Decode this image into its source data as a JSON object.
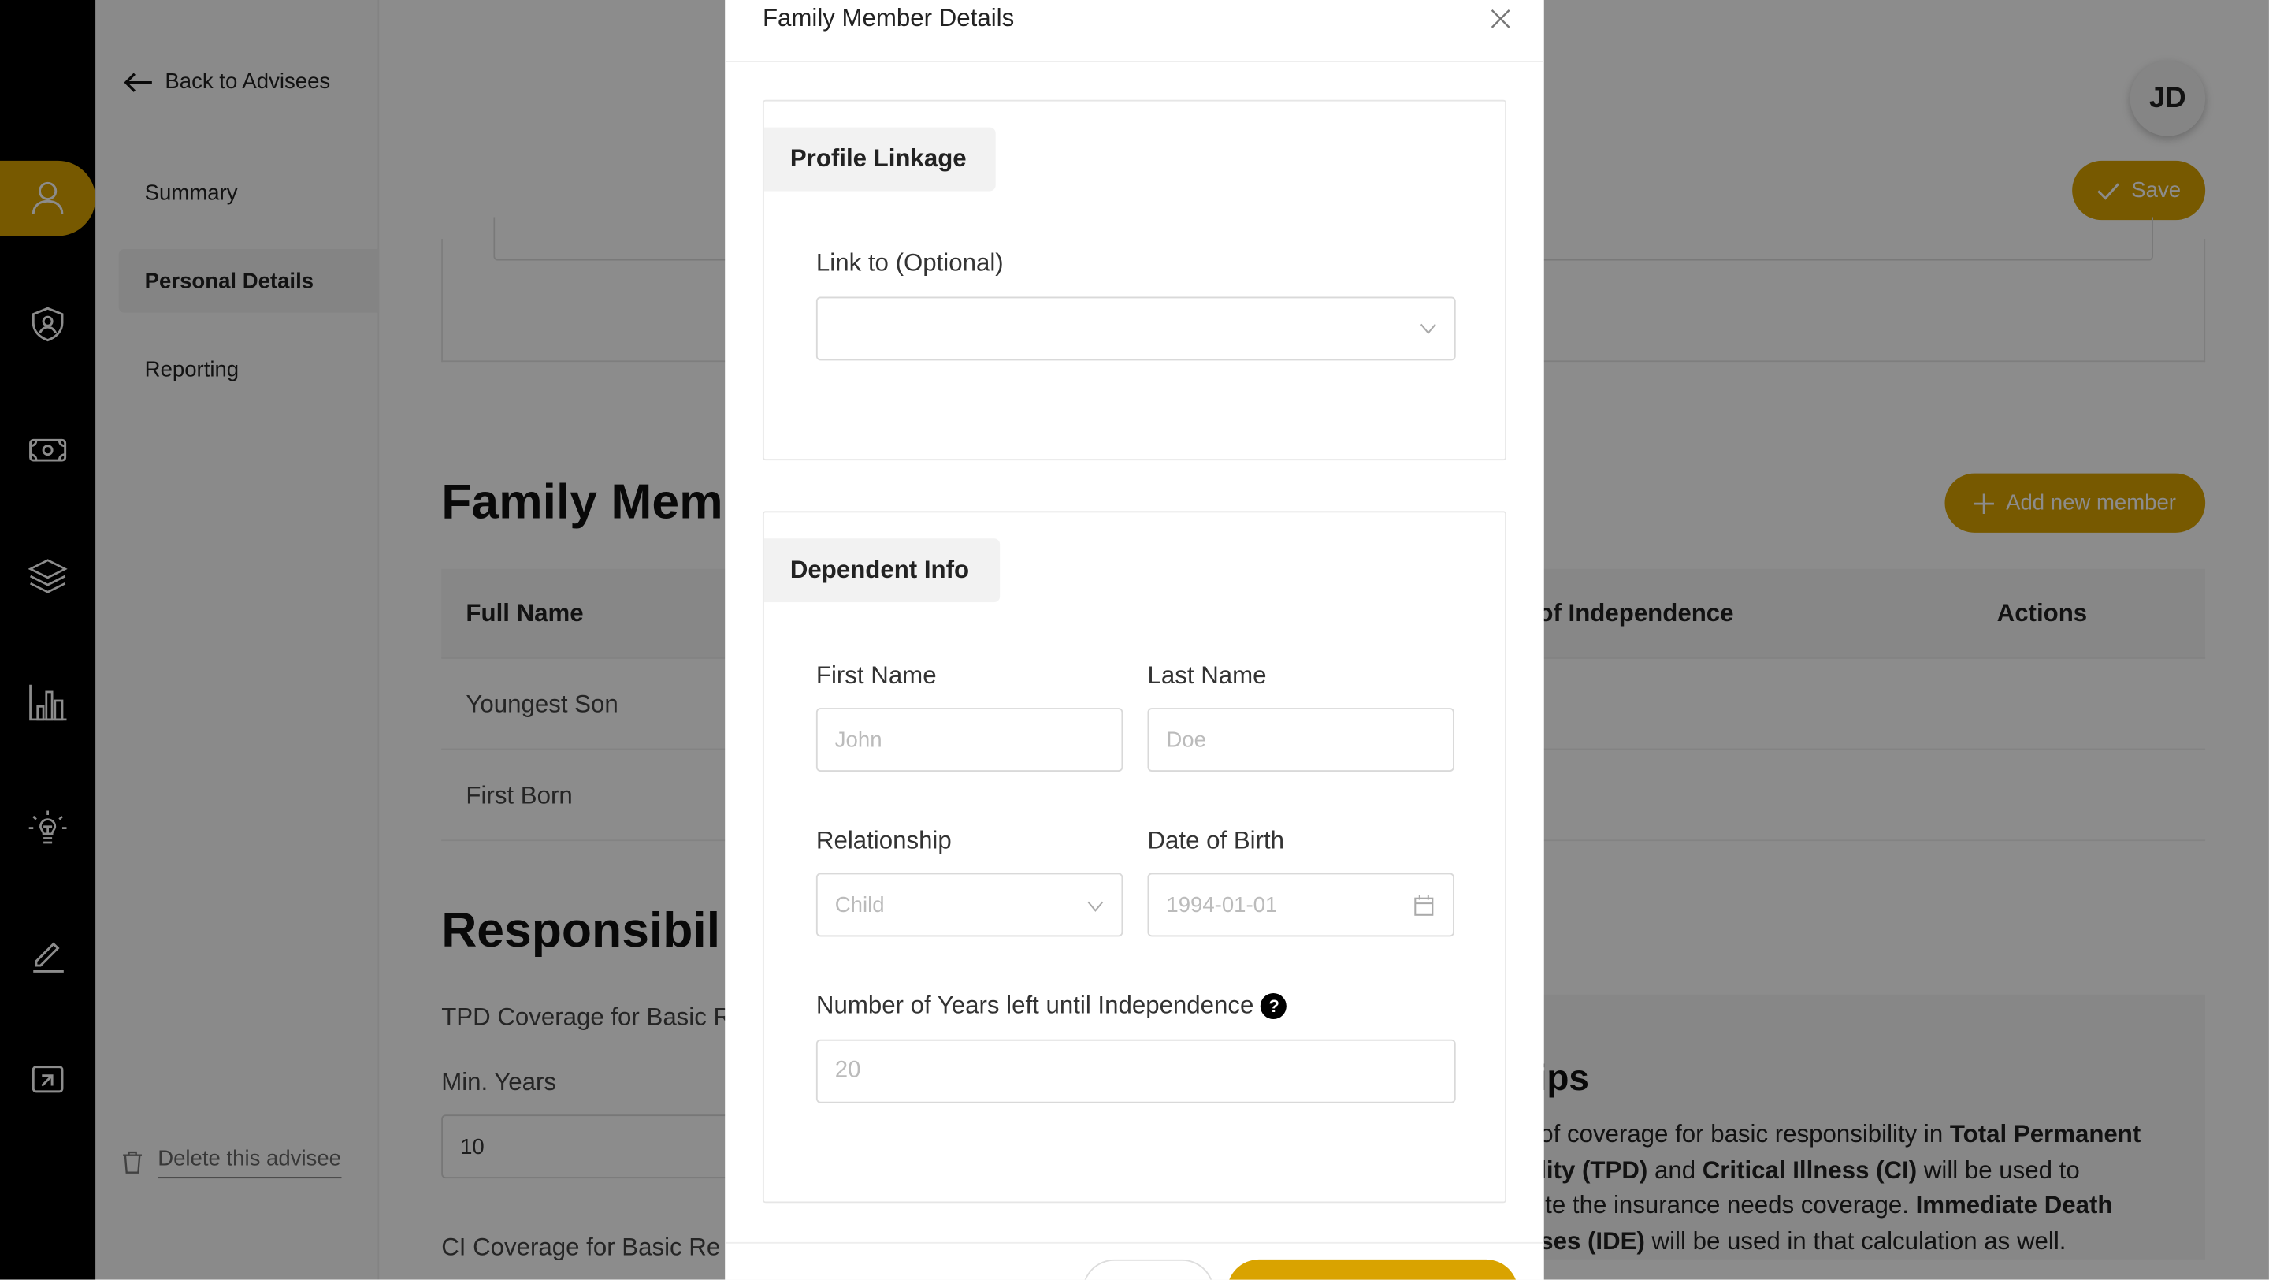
{
  "rail": {
    "items": [
      {
        "icon": "user-icon",
        "active": true
      },
      {
        "icon": "shield-user-icon"
      },
      {
        "icon": "money-icon"
      },
      {
        "icon": "layers-icon"
      },
      {
        "icon": "bar-chart-icon"
      },
      {
        "icon": "lightbulb-icon"
      },
      {
        "icon": "edit-icon"
      },
      {
        "icon": "export-icon"
      }
    ]
  },
  "subnav": {
    "back_label": "Back to Advisees",
    "items": [
      {
        "label": "Summary"
      },
      {
        "label": "Personal Details",
        "active": true
      },
      {
        "label": "Reporting"
      }
    ],
    "delete_label": "Delete this advisee"
  },
  "header": {
    "avatar_initials": "JD",
    "save_label": "Save"
  },
  "family": {
    "title": "Family Mem",
    "add_label": "Add new member",
    "columns": [
      "Full Name",
      "of Independence",
      "Actions"
    ],
    "rows": [
      "Youngest Son",
      "First Born"
    ]
  },
  "responsibilities": {
    "title": "Responsibil",
    "tpd_label": "TPD Coverage for Basic R",
    "min_years_label": "Min. Years",
    "min_years_value": "10",
    "ci_label": "CI Coverage for Basic Re"
  },
  "tips": {
    "title": "ips",
    "lines": [
      [
        {
          "t": "of coverage for basic responsibility in "
        },
        {
          "t": "Total Permanent",
          "b": true
        }
      ],
      [
        {
          "t": "lity (TPD)",
          "b": true
        },
        {
          "t": " and "
        },
        {
          "t": "Critical Illness (CI)",
          "b": true
        },
        {
          "t": " will be used to"
        }
      ],
      [
        {
          "t": "ite the insurance needs coverage. "
        },
        {
          "t": "Immediate Death",
          "b": true
        }
      ],
      [
        {
          "t": "ses (IDE)",
          "b": true
        },
        {
          "t": " will be used in that calculation as well."
        }
      ]
    ]
  },
  "modal": {
    "title": "Family Member Details",
    "profile_section": "Profile Linkage",
    "link_label": "Link to (Optional)",
    "link_value": "",
    "dependent_section": "Dependent Info",
    "first_name_label": "First Name",
    "first_name_placeholder": "John",
    "last_name_label": "Last Name",
    "last_name_placeholder": "Doe",
    "relationship_label": "Relationship",
    "relationship_value": "Child",
    "dob_label": "Date of Birth",
    "dob_placeholder": "1994-01-01",
    "years_label": "Number of Years left until Independence",
    "years_placeholder": "20"
  },
  "colors": {
    "accent": "#d9a300",
    "rail": "#000000",
    "overlay": "rgba(0,0,0,0.45)"
  }
}
